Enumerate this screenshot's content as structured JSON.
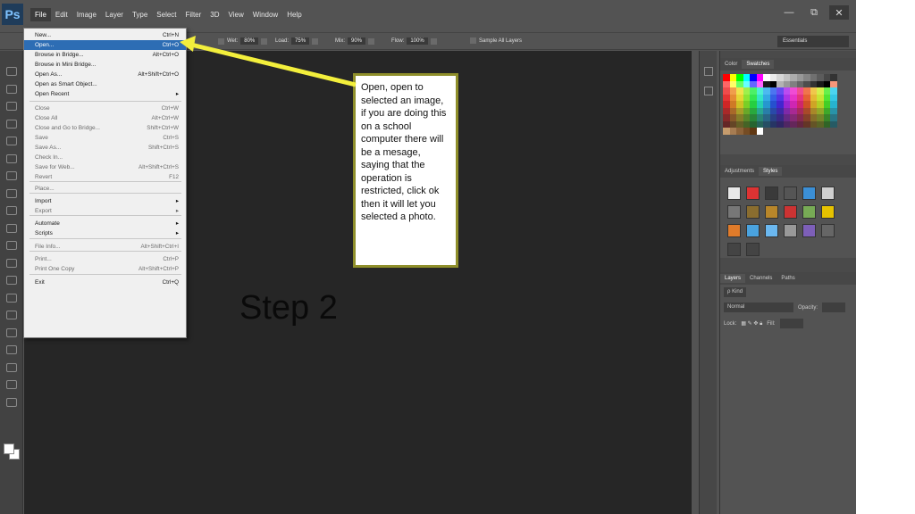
{
  "app": {
    "logo": "Ps"
  },
  "menubar": {
    "items": [
      "File",
      "Edit",
      "Image",
      "Layer",
      "Type",
      "Select",
      "Filter",
      "3D",
      "View",
      "Window",
      "Help"
    ],
    "window_buttons": [
      "—",
      "⧉",
      "✕"
    ]
  },
  "options": {
    "wet_label": "Wet:",
    "wet_value": "80%",
    "load_label": "Load:",
    "load_value": "75%",
    "mix_label": "Mix:",
    "mix_value": "90%",
    "flow_label": "Flow:",
    "flow_value": "100%",
    "sample_label": "Sample All Layers",
    "workspace": "Essentials"
  },
  "file_menu": {
    "items": [
      {
        "label": "New...",
        "shortcut": "Ctrl+N",
        "state": "normal"
      },
      {
        "label": "Open...",
        "shortcut": "Ctrl+O",
        "state": "highlight"
      },
      {
        "label": "Browse in Bridge...",
        "shortcut": "Alt+Ctrl+O",
        "state": "normal"
      },
      {
        "label": "Browse in Mini Bridge...",
        "shortcut": "",
        "state": "normal"
      },
      {
        "label": "Open As...",
        "shortcut": "Alt+Shift+Ctrl+O",
        "state": "normal"
      },
      {
        "label": "Open as Smart Object...",
        "shortcut": "",
        "state": "normal"
      },
      {
        "label": "Open Recent",
        "shortcut": "▸",
        "state": "normal"
      },
      {
        "label": "Close",
        "shortcut": "Ctrl+W",
        "state": "disabled"
      },
      {
        "label": "Close All",
        "shortcut": "Alt+Ctrl+W",
        "state": "disabled"
      },
      {
        "label": "Close and Go to Bridge...",
        "shortcut": "Shift+Ctrl+W",
        "state": "disabled"
      },
      {
        "label": "Save",
        "shortcut": "Ctrl+S",
        "state": "disabled"
      },
      {
        "label": "Save As...",
        "shortcut": "Shift+Ctrl+S",
        "state": "disabled"
      },
      {
        "label": "Check In...",
        "shortcut": "",
        "state": "disabled"
      },
      {
        "label": "Save for Web...",
        "shortcut": "Alt+Shift+Ctrl+S",
        "state": "disabled"
      },
      {
        "label": "Revert",
        "shortcut": "F12",
        "state": "disabled"
      },
      {
        "label": "Place...",
        "shortcut": "",
        "state": "disabled"
      },
      {
        "label": "Import",
        "shortcut": "▸",
        "state": "normal"
      },
      {
        "label": "Export",
        "shortcut": "▸",
        "state": "disabled"
      },
      {
        "label": "Automate",
        "shortcut": "▸",
        "state": "normal"
      },
      {
        "label": "Scripts",
        "shortcut": "▸",
        "state": "normal"
      },
      {
        "label": "File Info...",
        "shortcut": "Alt+Shift+Ctrl+I",
        "state": "disabled"
      },
      {
        "label": "Print...",
        "shortcut": "Ctrl+P",
        "state": "disabled"
      },
      {
        "label": "Print One Copy",
        "shortcut": "Alt+Shift+Ctrl+P",
        "state": "disabled"
      },
      {
        "label": "Exit",
        "shortcut": "Ctrl+Q",
        "state": "normal"
      }
    ]
  },
  "callout": {
    "text": "Open, open to selected an image, if you are doing this on a school computer there will be a mesage, saying that the operation is restricted, click ok then it will let you selected a photo."
  },
  "canvas": {
    "step_label": "Step 2"
  },
  "panels": {
    "color_tabs": [
      "Color",
      "Swatches"
    ],
    "adjust_tabs": [
      "Adjustments",
      "Styles"
    ],
    "layers_tabs": [
      "Layers",
      "Channels",
      "Paths"
    ],
    "layers_kind": "ρ Kind",
    "blend_mode": "Normal",
    "opacity_label": "Opacity:",
    "lock_label": "Lock:",
    "fill_label": "Fill:"
  },
  "colors": {
    "app_bg": "#535353",
    "canvas_bg": "#262626",
    "menu_highlight": "#2d6db4",
    "arrow": "#f3ef3c",
    "callout_border": "#8f8f2b"
  },
  "icons": {
    "tools": [
      "move-icon",
      "marquee-icon",
      "lasso-icon",
      "quick-select-icon",
      "crop-icon",
      "eyedropper-icon",
      "healing-icon",
      "brush-icon",
      "stamp-icon",
      "history-brush-icon",
      "eraser-icon",
      "gradient-icon",
      "blur-icon",
      "dodge-icon",
      "pen-icon",
      "type-icon",
      "path-select-icon",
      "shape-icon",
      "hand-icon",
      "zoom-icon"
    ]
  }
}
